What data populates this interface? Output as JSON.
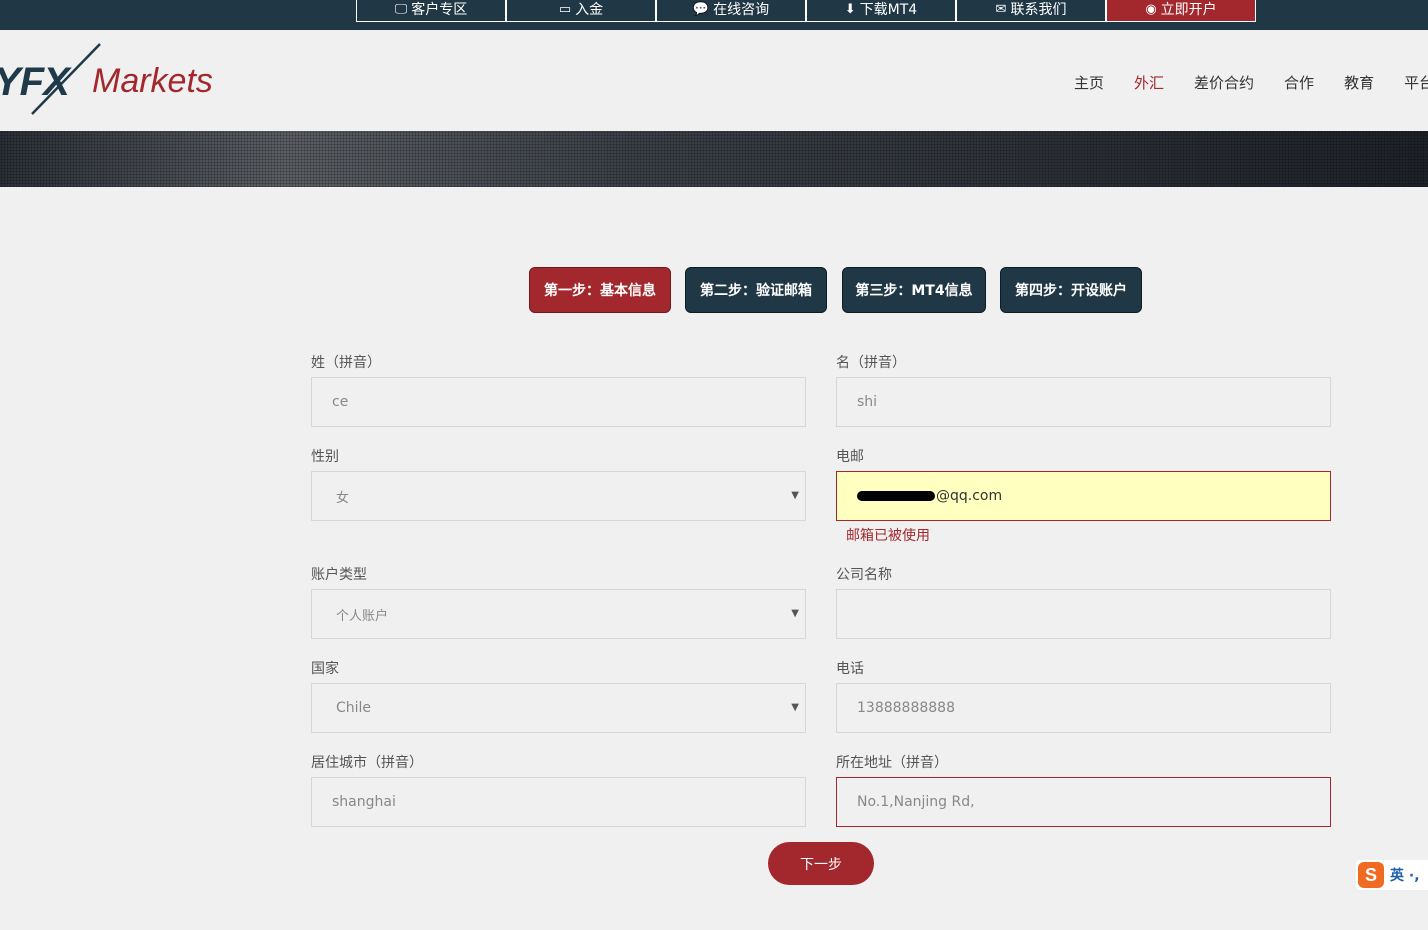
{
  "topbar": {
    "items": [
      {
        "icon": "monitor-icon",
        "label": "客户专区"
      },
      {
        "icon": "card-icon",
        "label": "入金"
      },
      {
        "icon": "chat-icon",
        "label": "在线咨询"
      },
      {
        "icon": "download-icon",
        "label": "下载MT4"
      },
      {
        "icon": "mail-icon",
        "label": "联系我们"
      },
      {
        "icon": "globe-icon",
        "label": "立即开户"
      }
    ]
  },
  "header": {
    "logo_yfx": "YFX",
    "logo_markets": "Markets",
    "nav": [
      "主页",
      "外汇",
      "差价合约",
      "合作",
      "教育",
      "平台"
    ],
    "active_nav": "外汇"
  },
  "steps": [
    "第一步：基本信息",
    "第二步：验证邮箱",
    "第三步：MT4信息",
    "第四步：开设账户"
  ],
  "form": {
    "last_name_label": "姓（拼音）",
    "last_name_value": "ce",
    "first_name_label": "名（拼音）",
    "first_name_value": "shi",
    "gender_label": "性别",
    "gender_value": "女",
    "email_label": "电邮",
    "email_value_suffix": "@qq.com",
    "email_error": "邮箱已被使用",
    "account_type_label": "账户类型",
    "account_type_value": "个人账户",
    "company_label": "公司名称",
    "company_value": "",
    "country_label": "国家",
    "country_value": "Chile",
    "phone_label": "电话",
    "phone_value": "13888888888",
    "city_label": "居住城市（拼音）",
    "city_value": "shanghai",
    "address_label": "所在地址（拼音）",
    "address_value": "No.1,Nanjing Rd,",
    "next_button": "下一步"
  },
  "ime": {
    "icon": "sogou-s-icon",
    "label": "英 ·,"
  },
  "colors": {
    "navy": "#203845",
    "accent_red": "#a3282d",
    "warn_bg": "#ffffc0"
  }
}
